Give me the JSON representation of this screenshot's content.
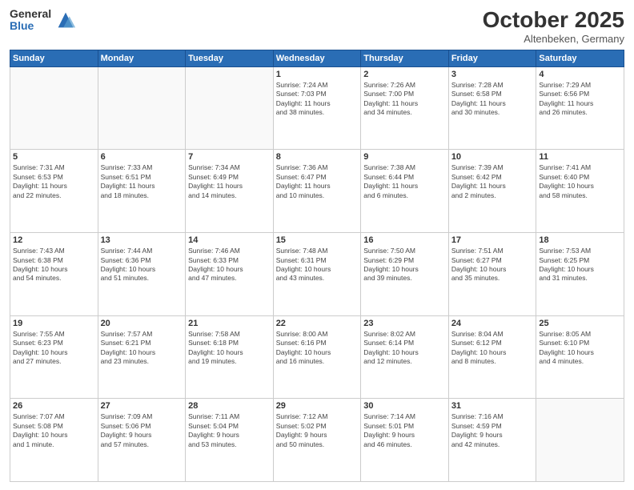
{
  "header": {
    "logo": {
      "general": "General",
      "blue": "Blue"
    },
    "title": "October 2025",
    "location": "Altenbeken, Germany"
  },
  "weekdays": [
    "Sunday",
    "Monday",
    "Tuesday",
    "Wednesday",
    "Thursday",
    "Friday",
    "Saturday"
  ],
  "weeks": [
    [
      {
        "day": "",
        "info": ""
      },
      {
        "day": "",
        "info": ""
      },
      {
        "day": "",
        "info": ""
      },
      {
        "day": "1",
        "info": "Sunrise: 7:24 AM\nSunset: 7:03 PM\nDaylight: 11 hours\nand 38 minutes."
      },
      {
        "day": "2",
        "info": "Sunrise: 7:26 AM\nSunset: 7:00 PM\nDaylight: 11 hours\nand 34 minutes."
      },
      {
        "day": "3",
        "info": "Sunrise: 7:28 AM\nSunset: 6:58 PM\nDaylight: 11 hours\nand 30 minutes."
      },
      {
        "day": "4",
        "info": "Sunrise: 7:29 AM\nSunset: 6:56 PM\nDaylight: 11 hours\nand 26 minutes."
      }
    ],
    [
      {
        "day": "5",
        "info": "Sunrise: 7:31 AM\nSunset: 6:53 PM\nDaylight: 11 hours\nand 22 minutes."
      },
      {
        "day": "6",
        "info": "Sunrise: 7:33 AM\nSunset: 6:51 PM\nDaylight: 11 hours\nand 18 minutes."
      },
      {
        "day": "7",
        "info": "Sunrise: 7:34 AM\nSunset: 6:49 PM\nDaylight: 11 hours\nand 14 minutes."
      },
      {
        "day": "8",
        "info": "Sunrise: 7:36 AM\nSunset: 6:47 PM\nDaylight: 11 hours\nand 10 minutes."
      },
      {
        "day": "9",
        "info": "Sunrise: 7:38 AM\nSunset: 6:44 PM\nDaylight: 11 hours\nand 6 minutes."
      },
      {
        "day": "10",
        "info": "Sunrise: 7:39 AM\nSunset: 6:42 PM\nDaylight: 11 hours\nand 2 minutes."
      },
      {
        "day": "11",
        "info": "Sunrise: 7:41 AM\nSunset: 6:40 PM\nDaylight: 10 hours\nand 58 minutes."
      }
    ],
    [
      {
        "day": "12",
        "info": "Sunrise: 7:43 AM\nSunset: 6:38 PM\nDaylight: 10 hours\nand 54 minutes."
      },
      {
        "day": "13",
        "info": "Sunrise: 7:44 AM\nSunset: 6:36 PM\nDaylight: 10 hours\nand 51 minutes."
      },
      {
        "day": "14",
        "info": "Sunrise: 7:46 AM\nSunset: 6:33 PM\nDaylight: 10 hours\nand 47 minutes."
      },
      {
        "day": "15",
        "info": "Sunrise: 7:48 AM\nSunset: 6:31 PM\nDaylight: 10 hours\nand 43 minutes."
      },
      {
        "day": "16",
        "info": "Sunrise: 7:50 AM\nSunset: 6:29 PM\nDaylight: 10 hours\nand 39 minutes."
      },
      {
        "day": "17",
        "info": "Sunrise: 7:51 AM\nSunset: 6:27 PM\nDaylight: 10 hours\nand 35 minutes."
      },
      {
        "day": "18",
        "info": "Sunrise: 7:53 AM\nSunset: 6:25 PM\nDaylight: 10 hours\nand 31 minutes."
      }
    ],
    [
      {
        "day": "19",
        "info": "Sunrise: 7:55 AM\nSunset: 6:23 PM\nDaylight: 10 hours\nand 27 minutes."
      },
      {
        "day": "20",
        "info": "Sunrise: 7:57 AM\nSunset: 6:21 PM\nDaylight: 10 hours\nand 23 minutes."
      },
      {
        "day": "21",
        "info": "Sunrise: 7:58 AM\nSunset: 6:18 PM\nDaylight: 10 hours\nand 19 minutes."
      },
      {
        "day": "22",
        "info": "Sunrise: 8:00 AM\nSunset: 6:16 PM\nDaylight: 10 hours\nand 16 minutes."
      },
      {
        "day": "23",
        "info": "Sunrise: 8:02 AM\nSunset: 6:14 PM\nDaylight: 10 hours\nand 12 minutes."
      },
      {
        "day": "24",
        "info": "Sunrise: 8:04 AM\nSunset: 6:12 PM\nDaylight: 10 hours\nand 8 minutes."
      },
      {
        "day": "25",
        "info": "Sunrise: 8:05 AM\nSunset: 6:10 PM\nDaylight: 10 hours\nand 4 minutes."
      }
    ],
    [
      {
        "day": "26",
        "info": "Sunrise: 7:07 AM\nSunset: 5:08 PM\nDaylight: 10 hours\nand 1 minute."
      },
      {
        "day": "27",
        "info": "Sunrise: 7:09 AM\nSunset: 5:06 PM\nDaylight: 9 hours\nand 57 minutes."
      },
      {
        "day": "28",
        "info": "Sunrise: 7:11 AM\nSunset: 5:04 PM\nDaylight: 9 hours\nand 53 minutes."
      },
      {
        "day": "29",
        "info": "Sunrise: 7:12 AM\nSunset: 5:02 PM\nDaylight: 9 hours\nand 50 minutes."
      },
      {
        "day": "30",
        "info": "Sunrise: 7:14 AM\nSunset: 5:01 PM\nDaylight: 9 hours\nand 46 minutes."
      },
      {
        "day": "31",
        "info": "Sunrise: 7:16 AM\nSunset: 4:59 PM\nDaylight: 9 hours\nand 42 minutes."
      },
      {
        "day": "",
        "info": ""
      }
    ]
  ]
}
